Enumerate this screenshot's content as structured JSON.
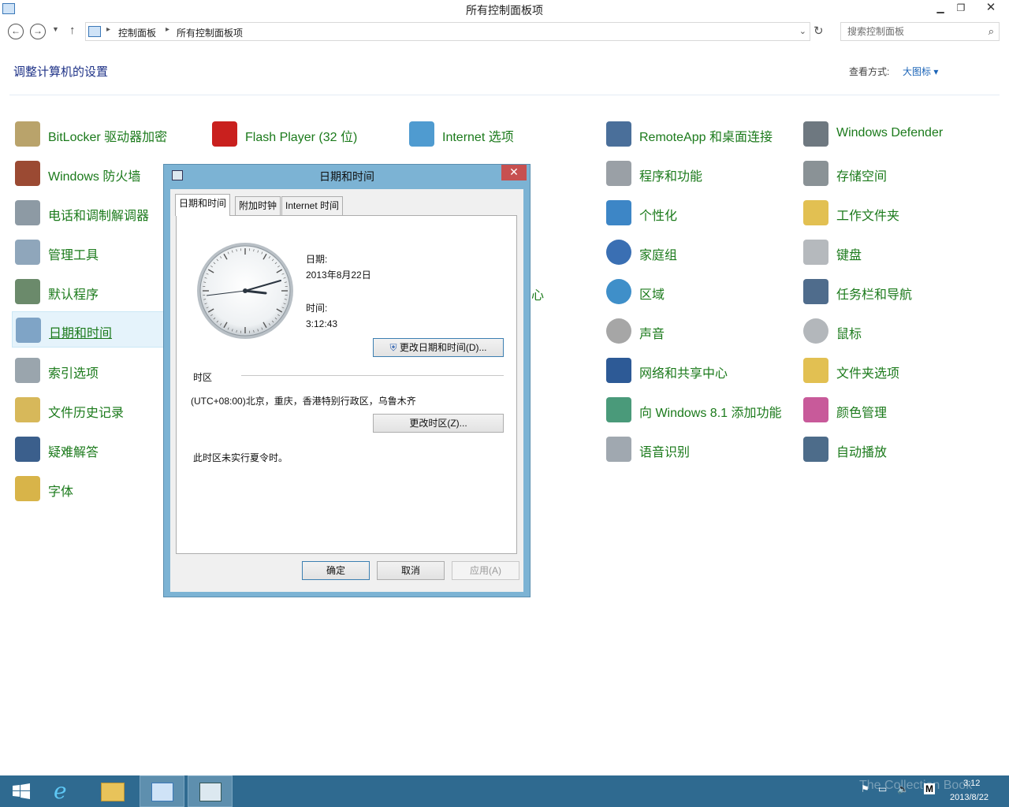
{
  "window": {
    "title": "所有控制面板项"
  },
  "address": {
    "crumbs": [
      "控制面板",
      "所有控制面板项"
    ],
    "search_placeholder": "搜索控制面板"
  },
  "header": {
    "heading": "调整计算机的设置",
    "view_label": "查看方式:",
    "view_value": "大图标 ▾"
  },
  "items": {
    "col1": [
      "BitLocker 驱动器加密",
      "Windows 防火墙",
      "电话和调制解调器",
      "管理工具",
      "默认程序",
      "日期和时间",
      "索引选项",
      "文件历史记录",
      "疑难解答",
      "字体"
    ],
    "col2": [
      "Flash Player (32 位)"
    ],
    "col3": [
      "Internet 选项",
      "心"
    ],
    "col4": [
      "RemoteApp 和桌面连接",
      "程序和功能",
      "个性化",
      "家庭组",
      "区域",
      "声音",
      "网络和共享中心",
      "向 Windows 8.1 添加功能",
      "语音识别"
    ],
    "col5": [
      "Windows Defender",
      "存储空间",
      "工作文件夹",
      "键盘",
      "任务栏和导航",
      "鼠标",
      "文件夹选项",
      "颜色管理",
      "自动播放"
    ]
  },
  "dialog": {
    "title": "日期和时间",
    "tabs": [
      "日期和时间",
      "附加时钟",
      "Internet 时间"
    ],
    "date_label": "日期:",
    "date_value": "2013年8月22日",
    "time_label": "时间:",
    "time_value": "3:12:43",
    "change_datetime": "更改日期和时间(D)...",
    "tz_label": "时区",
    "tz_value": "(UTC+08:00)北京，重庆，香港特别行政区，乌鲁木齐",
    "change_tz": "更改时区(Z)...",
    "dst_note": "此时区未实行夏令时。",
    "ok": "确定",
    "cancel": "取消",
    "apply": "应用(A)"
  },
  "taskbar": {
    "time": "3:12",
    "date": "2013/8/22",
    "watermark": "The Collection Book"
  },
  "colors": {
    "link_green": "#1b7a1b",
    "heading_blue": "#1e3287",
    "taskbar": "#2f6a90",
    "dialog_frame": "#7cb3d4"
  }
}
